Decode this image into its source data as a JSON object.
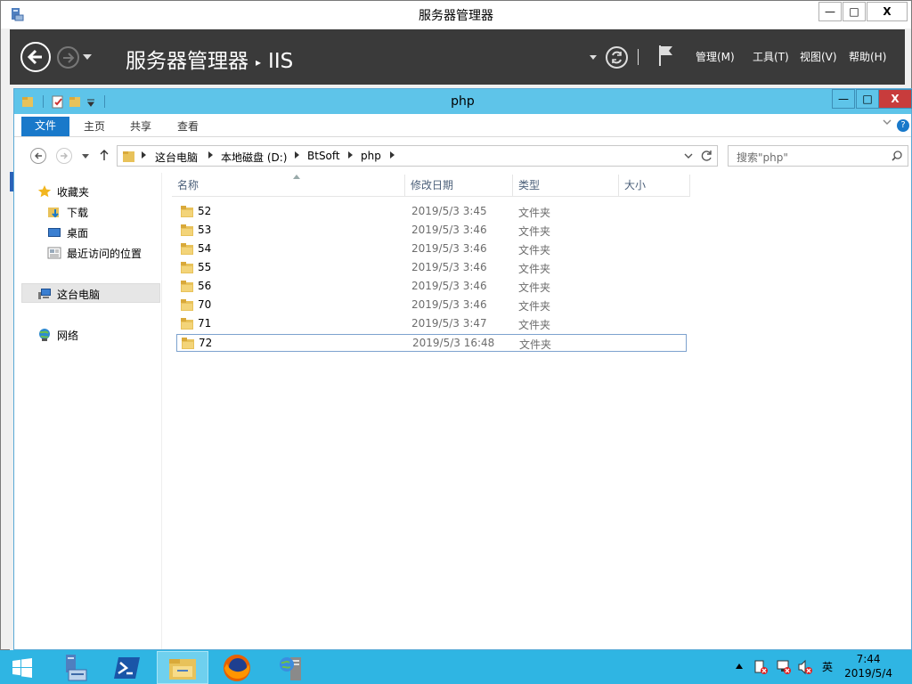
{
  "server_manager": {
    "title": "服务器管理器",
    "window_buttons": {
      "minimize": "—",
      "maximize": "□",
      "close": "X"
    },
    "breadcrumb": {
      "root": "服务器管理器",
      "separator": "▸",
      "current": "IIS"
    },
    "menu": [
      "管理(M)",
      "工具(T)",
      "视图(V)",
      "帮助(H)"
    ],
    "icons": {
      "back": "back-arrow-icon",
      "forward": "forward-arrow-icon",
      "refresh": "refresh-icon",
      "flag": "notifications-flag-icon"
    }
  },
  "explorer": {
    "title": "php",
    "window_buttons": {
      "minimize": "—",
      "maximize": "□",
      "close": "X"
    },
    "ribbon_tabs": [
      "文件",
      "主页",
      "共享",
      "查看"
    ],
    "address": {
      "parts": [
        "这台电脑",
        "本地磁盘 (D:)",
        "BtSoft",
        "php"
      ]
    },
    "search": {
      "placeholder": "搜索\"php\""
    },
    "nav_pane": {
      "favorites": {
        "label": "收藏夹",
        "items": [
          "下载",
          "桌面",
          "最近访问的位置"
        ]
      },
      "this_pc": "这台电脑",
      "network": "网络"
    },
    "columns": [
      "名称",
      "修改日期",
      "类型",
      "大小"
    ],
    "files": [
      {
        "name": "52",
        "date": "2019/5/3 3:45",
        "type": "文件夹"
      },
      {
        "name": "53",
        "date": "2019/5/3 3:46",
        "type": "文件夹"
      },
      {
        "name": "54",
        "date": "2019/5/3 3:46",
        "type": "文件夹"
      },
      {
        "name": "55",
        "date": "2019/5/3 3:46",
        "type": "文件夹"
      },
      {
        "name": "56",
        "date": "2019/5/3 3:46",
        "type": "文件夹"
      },
      {
        "name": "70",
        "date": "2019/5/3 3:46",
        "type": "文件夹"
      },
      {
        "name": "71",
        "date": "2019/5/3 3:47",
        "type": "文件夹"
      },
      {
        "name": "72",
        "date": "2019/5/3 16:48",
        "type": "文件夹"
      }
    ],
    "selected_file": "72"
  },
  "taskbar": {
    "items": [
      "windows-start-icon",
      "server-manager-icon",
      "powershell-icon",
      "file-explorer-icon",
      "firefox-icon",
      "iis-manager-icon"
    ],
    "tray": {
      "ime": "英"
    },
    "clock": {
      "time": "7:44",
      "date": "2019/5/4"
    }
  },
  "colors": {
    "explorer_titlebar": "#5ec4e9",
    "ribbon_file_tab": "#1979ca",
    "server_manager_header": "#3a3a3a",
    "taskbar": "#2fb5e3",
    "folder": "#e8c25a"
  }
}
